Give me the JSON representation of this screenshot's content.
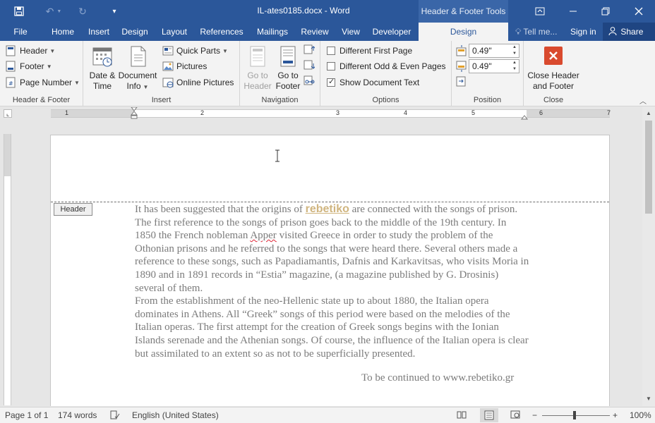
{
  "window": {
    "title": "IL-ates0185.docx - Word",
    "context_tab_group": "Header & Footer Tools"
  },
  "tabs": {
    "file": "File",
    "home": "Home",
    "insert": "Insert",
    "design": "Design",
    "layout": "Layout",
    "references": "References",
    "mailings": "Mailings",
    "review": "Review",
    "view": "View",
    "developer": "Developer",
    "context_design": "Design",
    "tell_me": "Tell me...",
    "sign_in": "Sign in",
    "share": "Share"
  },
  "ribbon": {
    "header_footer": {
      "header": "Header",
      "footer": "Footer",
      "page_number": "Page Number",
      "label": "Header & Footer"
    },
    "insert": {
      "date_time": [
        "Date &",
        "Time"
      ],
      "document_info": [
        "Document",
        "Info"
      ],
      "quick_parts": "Quick Parts",
      "pictures": "Pictures",
      "online_pictures": "Online Pictures",
      "label": "Insert"
    },
    "navigation": {
      "go_to_header": [
        "Go to",
        "Header"
      ],
      "go_to_footer": [
        "Go to",
        "Footer"
      ],
      "label": "Navigation"
    },
    "options": {
      "different_first_page": "Different First Page",
      "different_odd_even": "Different Odd & Even Pages",
      "show_document_text": "Show Document Text",
      "show_document_text_checked": true,
      "label": "Options"
    },
    "position": {
      "header_from_top": "0.49\"",
      "footer_from_bottom": "0.49\"",
      "label": "Position"
    },
    "close": {
      "close_button": [
        "Close Header",
        "and Footer"
      ],
      "label": "Close"
    }
  },
  "ruler": {
    "ticks": [
      "1",
      "2",
      "3",
      "4",
      "5",
      "6",
      "7"
    ]
  },
  "document": {
    "header_tag": "Header",
    "para1_before": "It has been suggested that the origins of ",
    "para1_keyword": "rebetiko",
    "para1_after1": " are connected with the songs of prison. The first reference to the songs of prison goes back to the middle of the 19th century. In 1850 the French nobleman ",
    "para1_misspelled": "Apper",
    "para1_after2": " visited Greece in order to study the problem of the Othonian prisons and he referred to the songs that were heard there. Several others made a reference to these songs, such as Papadiamantis, Dafnis and Karkavitsas, who visits Moria in 1890 and in 1891 records in “Estia” magazine, (a magazine published by G. Drosinis) several of them.",
    "para2": "From the establishment of the neo-Hellenic state up to about 1880, the Italian opera dominates in Athens. All “Greek” songs of this period were based on the melodies of the Italian operas. The first attempt for the creation of Greek songs begins with the Ionian Islands serenade and the Athenian songs. Of course, the influence of the Italian opera is clear but assimilated to an extent so as not to be superficially presented.",
    "continued": "To be continued to www.rebetiko.gr"
  },
  "status": {
    "page": "Page 1 of 1",
    "words": "174 words",
    "language": "English (United States)",
    "zoom": "100%"
  }
}
